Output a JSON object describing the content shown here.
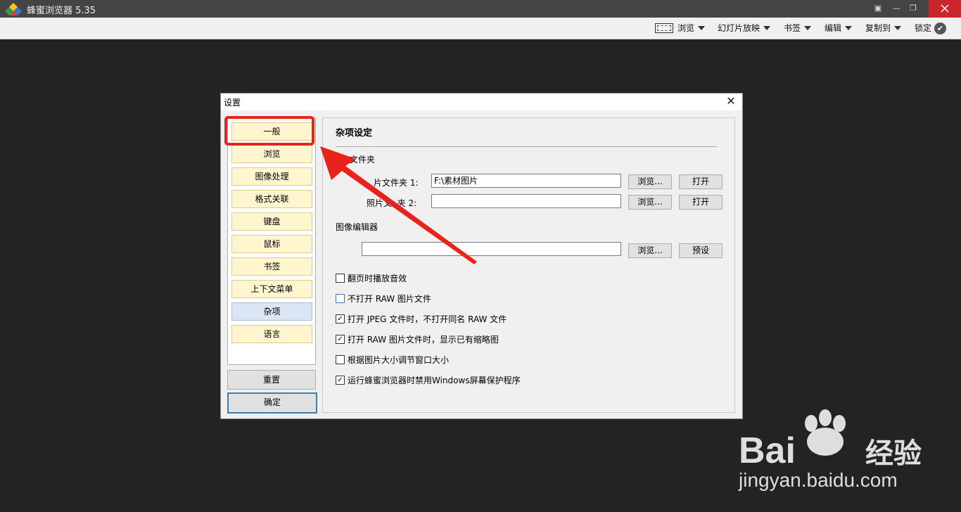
{
  "app": {
    "title": "蜂蜜浏览器 5.35"
  },
  "toolbar": {
    "browse": "浏览",
    "slideshow": "幻灯片放映",
    "bookmark": "书签",
    "edit": "编辑",
    "copy_to": "复制到",
    "lock": "锁定"
  },
  "dialog": {
    "title": "设置",
    "nav": [
      "一般",
      "浏览",
      "图像处理",
      "格式关联",
      "键盘",
      "鼠标",
      "书签",
      "上下文菜单",
      "杂项",
      "语言"
    ],
    "active_nav": "杂项",
    "reset": "重置",
    "ok": "确定",
    "section_title": "杂项设定",
    "photo_folder_group": "片文件夹",
    "folder1_label": "片文件夹 1:",
    "folder1_value": "F:\\素材图片",
    "folder2_label": "照片文",
    "folder2_label_tail": "夹 2:",
    "folder2_value": "",
    "browse_btn": "浏览...",
    "open_btn": "打开",
    "image_editor_group": "图像编辑器",
    "editor_value": "",
    "preset_btn": "预设",
    "checkboxes": [
      {
        "label": "翻页时播放音效",
        "checked": false
      },
      {
        "label": "不打开 RAW 图片文件",
        "checked": false
      },
      {
        "label": "打开 JPEG 文件时，不打开同名 RAW 文件",
        "checked": true
      },
      {
        "label": "打开 RAW 图片文件时，显示已有缩略图",
        "checked": true
      },
      {
        "label": "根据图片大小调节窗口大小",
        "checked": false
      },
      {
        "label": "运行蜂蜜浏览器时禁用Windows屏幕保护程序",
        "checked": true
      }
    ]
  },
  "watermark": {
    "brand": "Bai",
    "brand2": "经验",
    "url": "jingyan.baidu.com"
  },
  "colors": {
    "highlight": "#e8231b",
    "arrow": "#e8231b"
  }
}
